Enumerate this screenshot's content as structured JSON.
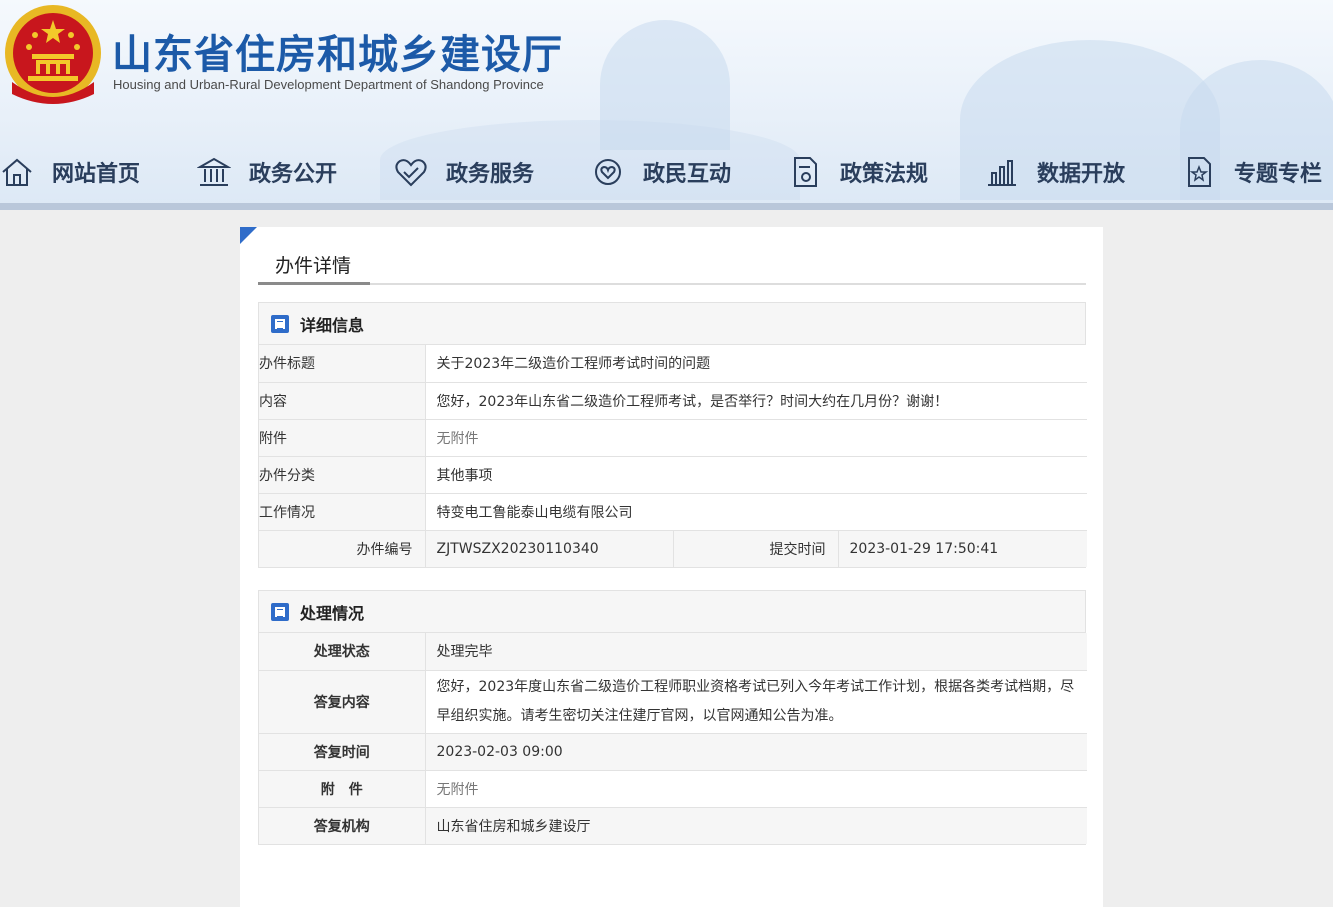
{
  "header": {
    "title": "山东省住房和城乡建设厅",
    "subtitle": "Housing and Urban-Rural Development Department of Shandong Province"
  },
  "nav": [
    {
      "label": "网站首页",
      "icon": "home-icon"
    },
    {
      "label": "政务公开",
      "icon": "government-building-icon"
    },
    {
      "label": "政务服务",
      "icon": "handshake-heart-icon"
    },
    {
      "label": "政民互动",
      "icon": "interaction-icon"
    },
    {
      "label": "政策法规",
      "icon": "policy-document-icon"
    },
    {
      "label": "数据开放",
      "icon": "data-chart-icon"
    },
    {
      "label": "专题专栏",
      "icon": "special-topic-icon"
    }
  ],
  "panel": {
    "tab_title": "办件详情"
  },
  "details": {
    "section_title": "详细信息",
    "rows": [
      {
        "label": "办件标题",
        "value": "关于2023年二级造价工程师考试时间的问题"
      },
      {
        "label": "内容",
        "value": "您好，2023年山东省二级造价工程师考试，是否举行？时间大约在几月份？谢谢！"
      },
      {
        "label": "附件",
        "value": "无附件"
      },
      {
        "label": "办件分类",
        "value": "其他事项"
      },
      {
        "label": "工作情况",
        "value": "特变电工鲁能泰山电缆有限公司"
      }
    ],
    "number_label": "办件编号",
    "number_value": "ZJTWSZX20230110340",
    "submit_label": "提交时间",
    "submit_value": "2023-01-29 17:50:41"
  },
  "processing": {
    "section_title": "处理情况",
    "rows": [
      {
        "label": "处理状态",
        "value": "处理完毕"
      },
      {
        "label": "答复内容",
        "value": "您好，2023年度山东省二级造价工程师职业资格考试已列入今年考试工作计划，根据各类考试档期，尽早组织实施。请考生密切关注住建厅官网，以官网通知公告为准。"
      },
      {
        "label": "答复时间",
        "value": "2023-02-03 09:00"
      },
      {
        "label": "附　件",
        "value": "无附件"
      },
      {
        "label": "答复机构",
        "value": "山东省住房和城乡建设厅"
      }
    ]
  },
  "colors": {
    "brand_blue": "#1c5aa8",
    "accent_blue": "#2f6cc9",
    "nav_text": "#2a3e5c"
  }
}
